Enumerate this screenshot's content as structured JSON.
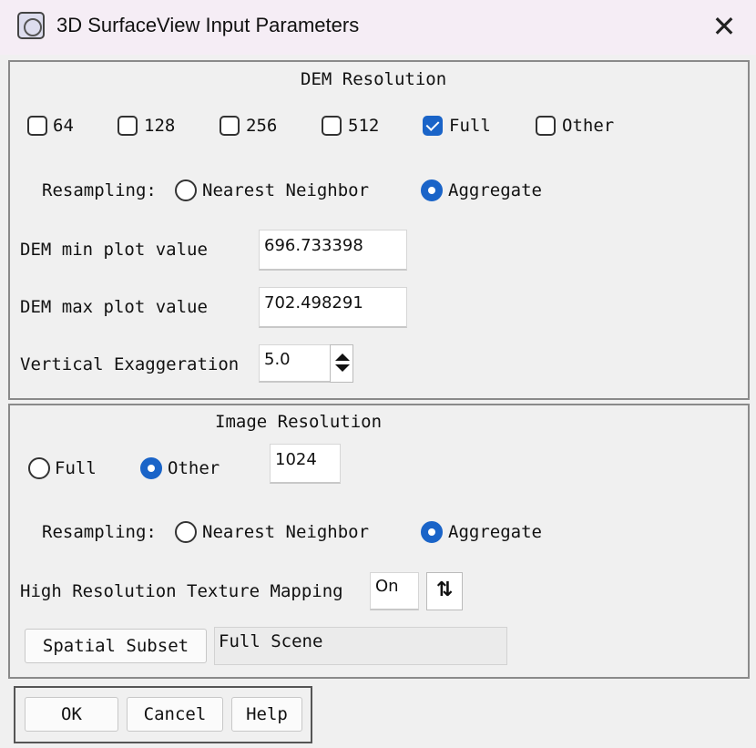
{
  "window": {
    "title": "3D SurfaceView Input Parameters",
    "close_glyph": "✕"
  },
  "dem": {
    "section_title": "DEM Resolution",
    "resolutions": [
      {
        "label": "64",
        "checked": false
      },
      {
        "label": "128",
        "checked": false
      },
      {
        "label": "256",
        "checked": false
      },
      {
        "label": "512",
        "checked": false
      },
      {
        "label": "Full",
        "checked": true
      },
      {
        "label": "Other",
        "checked": false
      }
    ],
    "resampling_label": "Resampling:",
    "resampling_options": [
      {
        "label": "Nearest Neighbor",
        "selected": false
      },
      {
        "label": "Aggregate",
        "selected": true
      }
    ],
    "min_label": "DEM min plot value",
    "min_value": "696.733398",
    "max_label": "DEM max plot value",
    "max_value": "702.498291",
    "exag_label": "Vertical Exaggeration",
    "exag_value": "5.0"
  },
  "image": {
    "section_title": "Image Resolution",
    "resolution_options": [
      {
        "label": "Full",
        "selected": false
      },
      {
        "label": "Other",
        "selected": true
      }
    ],
    "other_value": "1024",
    "resampling_label": "Resampling:",
    "resampling_options": [
      {
        "label": "Nearest Neighbor",
        "selected": false
      },
      {
        "label": "Aggregate",
        "selected": true
      }
    ],
    "texture_label": "High Resolution Texture Mapping",
    "texture_value": "On",
    "texture_toggle_icon": "sort-arrows-icon",
    "subset_button": "Spatial Subset",
    "subset_value": "Full Scene"
  },
  "buttons": {
    "ok": "OK",
    "cancel": "Cancel",
    "help": "Help"
  },
  "colors": {
    "accent": "#1a64c8",
    "titlebar": "#f5edf5",
    "dialog_bg": "#f0f0f0"
  }
}
